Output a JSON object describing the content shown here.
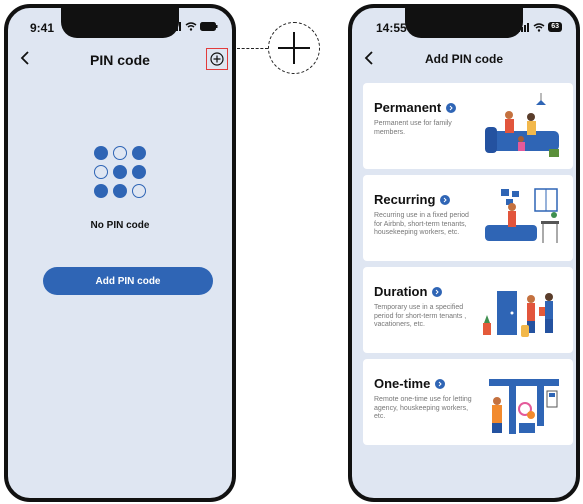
{
  "left_phone": {
    "time": "9:41",
    "title": "PIN code",
    "empty_text": "No PIN code",
    "add_button": "Add PIN code"
  },
  "right_phone": {
    "time": "14:55",
    "title": "Add PIN code",
    "battery": "63",
    "cards": [
      {
        "title": "Permanent",
        "desc": "Permanent use for family members."
      },
      {
        "title": "Recurring",
        "desc": "Recurring use in a fixed period for Airbnb, short-term tenants, housekeeping workers, etc."
      },
      {
        "title": "Duration",
        "desc": "Temporary use in a specified period for short-term tenants , vacationers, etc."
      },
      {
        "title": "One-time",
        "desc": "Remote one-time use for letting agency, houskeeping workers, etc."
      }
    ]
  },
  "colors": {
    "accent": "#2f65b5",
    "background": "#dfe6f2",
    "highlight": "#e23b3b"
  }
}
